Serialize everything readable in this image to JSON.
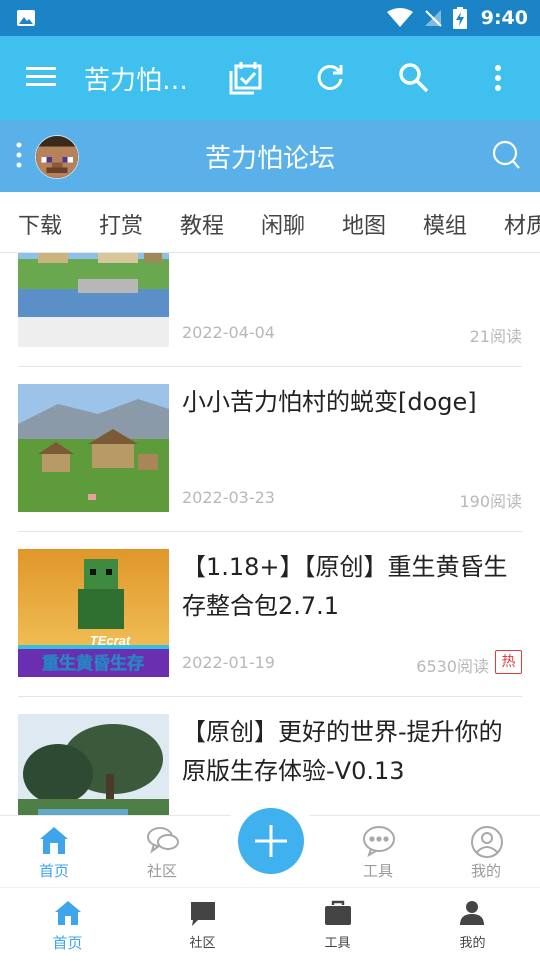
{
  "status_bar": {
    "time": "9:40"
  },
  "app_bar": {
    "title": "苦力怕…",
    "actions": [
      "calendar-check-icon",
      "refresh-icon",
      "search-icon",
      "more-vert-icon"
    ]
  },
  "forum_bar": {
    "title": "苦力怕论坛"
  },
  "tabs": [
    "下载",
    "打赏",
    "教程",
    "闲聊",
    "地图",
    "模组",
    "材质"
  ],
  "posts": [
    {
      "title": "",
      "date": "2022-04-04",
      "reads": "21阅读",
      "hot": ""
    },
    {
      "title": "小小苦力怕村的蜕变[doge]",
      "date": "2022-03-23",
      "reads": "190阅读",
      "hot": ""
    },
    {
      "title": "【1.18+】【原创】重生黄昏生存整合包2.7.1",
      "date": "2022-01-19",
      "reads": "6530阅读",
      "hot": "热",
      "thumb_caption": "TEcrat",
      "thumb_banner": "重生黄昏生存"
    },
    {
      "title": "【原创】更好的世界-提升你的原版生存体验-V0.13",
      "date": "",
      "reads": "",
      "hot": ""
    }
  ],
  "bottom_nav_primary": [
    {
      "label": "首页",
      "icon": "home-icon",
      "active": true
    },
    {
      "label": "社区",
      "icon": "community-chat-icon",
      "active": false
    },
    {
      "label": "工具",
      "icon": "tools-chat-icon",
      "active": false
    },
    {
      "label": "我的",
      "icon": "profile-icon",
      "active": false
    }
  ],
  "bottom_nav_secondary": [
    {
      "label": "首页",
      "icon": "home-icon",
      "active": true
    },
    {
      "label": "社区",
      "icon": "chat-bubble-icon",
      "active": false
    },
    {
      "label": "工具",
      "icon": "briefcase-icon",
      "active": false
    },
    {
      "label": "我的",
      "icon": "person-icon",
      "active": false
    }
  ],
  "colors": {
    "status_bar": "#1b84c6",
    "app_bar": "#3fc0ee",
    "forum_bar": "#5ab1ea",
    "accent": "#3fa5ea",
    "hot": "#e23b3b"
  }
}
